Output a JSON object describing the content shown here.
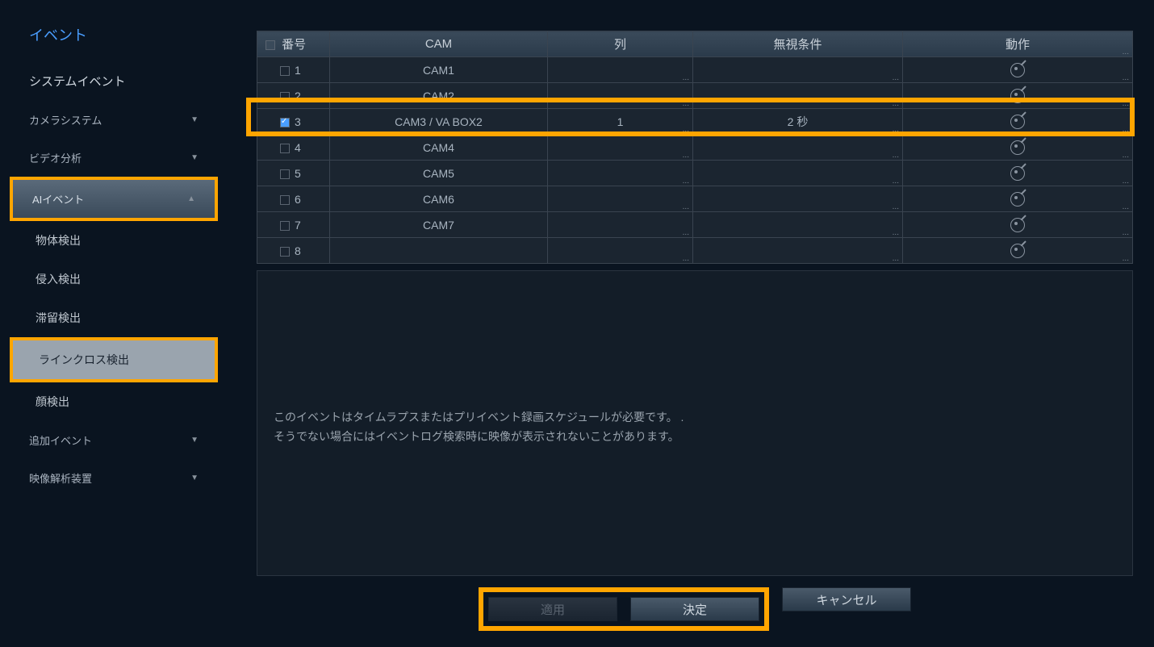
{
  "sidebar": {
    "title": "イベント",
    "items": [
      {
        "label": "システムイベント",
        "type": "item"
      },
      {
        "label": "カメラシステム",
        "type": "collapsible",
        "expanded": false
      },
      {
        "label": "ビデオ分析",
        "type": "collapsible",
        "expanded": false
      },
      {
        "label": "AIイベント",
        "type": "collapsible",
        "expanded": true,
        "highlighted": true
      },
      {
        "label": "物体検出",
        "type": "sub"
      },
      {
        "label": "侵入検出",
        "type": "sub"
      },
      {
        "label": "滞留検出",
        "type": "sub"
      },
      {
        "label": "ラインクロス検出",
        "type": "sub",
        "selected": true,
        "highlighted": true
      },
      {
        "label": "顔検出",
        "type": "sub"
      },
      {
        "label": "追加イベント",
        "type": "collapsible",
        "expanded": false
      },
      {
        "label": "映像解析装置",
        "type": "collapsible",
        "expanded": false
      }
    ]
  },
  "table": {
    "headers": {
      "num": "番号",
      "cam": "CAM",
      "row": "列",
      "ignore": "無視条件",
      "action": "動作"
    },
    "rows": [
      {
        "num": "1",
        "cam": "CAM1",
        "row": "",
        "ignore": "",
        "checked": false,
        "highlighted": false
      },
      {
        "num": "2",
        "cam": "CAM2",
        "row": "",
        "ignore": "",
        "checked": false,
        "highlighted": false
      },
      {
        "num": "3",
        "cam": "CAM3 / VA BOX2",
        "row": "1",
        "ignore": "2 秒",
        "checked": true,
        "highlighted": true
      },
      {
        "num": "4",
        "cam": "CAM4",
        "row": "",
        "ignore": "",
        "checked": false,
        "highlighted": false
      },
      {
        "num": "5",
        "cam": "CAM5",
        "row": "",
        "ignore": "",
        "checked": false,
        "highlighted": false
      },
      {
        "num": "6",
        "cam": "CAM6",
        "row": "",
        "ignore": "",
        "checked": false,
        "highlighted": false
      },
      {
        "num": "7",
        "cam": "CAM7",
        "row": "",
        "ignore": "",
        "checked": false,
        "highlighted": false
      },
      {
        "num": "8",
        "cam": "",
        "row": "",
        "ignore": "",
        "checked": false,
        "highlighted": false
      }
    ]
  },
  "info": {
    "line1": "このイベントはタイムラプスまたはプリイベント録画スケジュールが必要です。 .",
    "line2": "そうでない場合にはイベントログ検索時に映像が表示されないことがあります。"
  },
  "buttons": {
    "apply": "適用",
    "ok": "決定",
    "cancel": "キャンセル"
  }
}
